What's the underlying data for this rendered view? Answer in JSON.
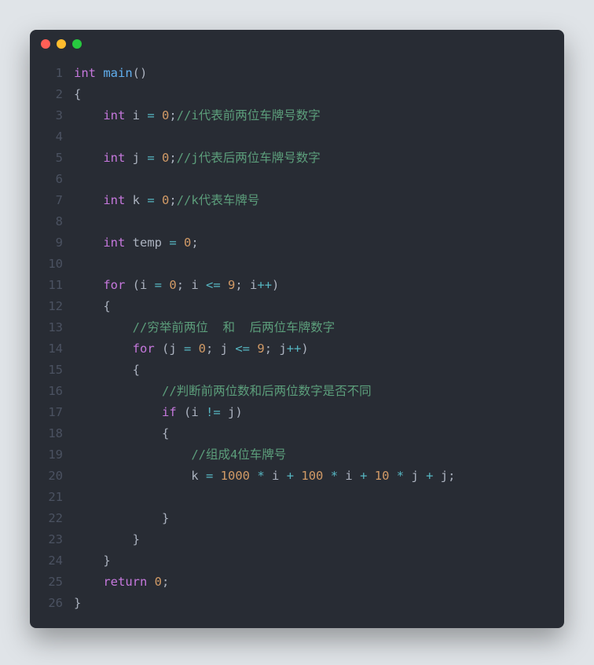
{
  "window": {
    "traffic_lights": [
      "red",
      "yellow",
      "green"
    ]
  },
  "code": {
    "line_numbers": [
      "1",
      "2",
      "3",
      "4",
      "5",
      "6",
      "7",
      "8",
      "9",
      "10",
      "11",
      "12",
      "13",
      "14",
      "15",
      "16",
      "17",
      "18",
      "19",
      "20",
      "21",
      "22",
      "23",
      "24",
      "25",
      "26"
    ],
    "lines": [
      [
        [
          "kw",
          "int"
        ],
        [
          "p",
          " "
        ],
        [
          "fn",
          "main"
        ],
        [
          "p",
          "()"
        ]
      ],
      [
        [
          "p",
          "{"
        ]
      ],
      [
        [
          "p",
          "    "
        ],
        [
          "kw",
          "int"
        ],
        [
          "p",
          " i "
        ],
        [
          "op",
          "="
        ],
        [
          "p",
          " "
        ],
        [
          "num",
          "0"
        ],
        [
          "p",
          ";"
        ],
        [
          "cm",
          "//i代表前两位车牌号数字"
        ]
      ],
      [],
      [
        [
          "p",
          "    "
        ],
        [
          "kw",
          "int"
        ],
        [
          "p",
          " j "
        ],
        [
          "op",
          "="
        ],
        [
          "p",
          " "
        ],
        [
          "num",
          "0"
        ],
        [
          "p",
          ";"
        ],
        [
          "cm",
          "//j代表后两位车牌号数字"
        ]
      ],
      [],
      [
        [
          "p",
          "    "
        ],
        [
          "kw",
          "int"
        ],
        [
          "p",
          " k "
        ],
        [
          "op",
          "="
        ],
        [
          "p",
          " "
        ],
        [
          "num",
          "0"
        ],
        [
          "p",
          ";"
        ],
        [
          "cm",
          "//k代表车牌号"
        ]
      ],
      [],
      [
        [
          "p",
          "    "
        ],
        [
          "kw",
          "int"
        ],
        [
          "p",
          " temp "
        ],
        [
          "op",
          "="
        ],
        [
          "p",
          " "
        ],
        [
          "num",
          "0"
        ],
        [
          "p",
          ";"
        ]
      ],
      [],
      [
        [
          "p",
          "    "
        ],
        [
          "kw",
          "for"
        ],
        [
          "p",
          " (i "
        ],
        [
          "op",
          "="
        ],
        [
          "p",
          " "
        ],
        [
          "num",
          "0"
        ],
        [
          "p",
          "; i "
        ],
        [
          "op",
          "<="
        ],
        [
          "p",
          " "
        ],
        [
          "num",
          "9"
        ],
        [
          "p",
          "; i"
        ],
        [
          "op",
          "++"
        ],
        [
          "p",
          ")"
        ]
      ],
      [
        [
          "p",
          "    {"
        ]
      ],
      [
        [
          "p",
          "        "
        ],
        [
          "cm",
          "//穷举前两位  和  后两位车牌数字"
        ]
      ],
      [
        [
          "p",
          "        "
        ],
        [
          "kw",
          "for"
        ],
        [
          "p",
          " (j "
        ],
        [
          "op",
          "="
        ],
        [
          "p",
          " "
        ],
        [
          "num",
          "0"
        ],
        [
          "p",
          "; j "
        ],
        [
          "op",
          "<="
        ],
        [
          "p",
          " "
        ],
        [
          "num",
          "9"
        ],
        [
          "p",
          "; j"
        ],
        [
          "op",
          "++"
        ],
        [
          "p",
          ")"
        ]
      ],
      [
        [
          "p",
          "        {"
        ]
      ],
      [
        [
          "p",
          "            "
        ],
        [
          "cm",
          "//判断前两位数和后两位数字是否不同"
        ]
      ],
      [
        [
          "p",
          "            "
        ],
        [
          "kw",
          "if"
        ],
        [
          "p",
          " (i "
        ],
        [
          "op",
          "!="
        ],
        [
          "p",
          " j)"
        ]
      ],
      [
        [
          "p",
          "            {"
        ]
      ],
      [
        [
          "p",
          "                "
        ],
        [
          "cm",
          "//组成4位车牌号"
        ]
      ],
      [
        [
          "p",
          "                k "
        ],
        [
          "op",
          "="
        ],
        [
          "p",
          " "
        ],
        [
          "num",
          "1000"
        ],
        [
          "p",
          " "
        ],
        [
          "op",
          "*"
        ],
        [
          "p",
          " i "
        ],
        [
          "op",
          "+"
        ],
        [
          "p",
          " "
        ],
        [
          "num",
          "100"
        ],
        [
          "p",
          " "
        ],
        [
          "op",
          "*"
        ],
        [
          "p",
          " i "
        ],
        [
          "op",
          "+"
        ],
        [
          "p",
          " "
        ],
        [
          "num",
          "10"
        ],
        [
          "p",
          " "
        ],
        [
          "op",
          "*"
        ],
        [
          "p",
          " j "
        ],
        [
          "op",
          "+"
        ],
        [
          "p",
          " j;"
        ]
      ],
      [],
      [
        [
          "p",
          "            }"
        ]
      ],
      [
        [
          "p",
          "        }"
        ]
      ],
      [
        [
          "p",
          "    }"
        ]
      ],
      [
        [
          "p",
          "    "
        ],
        [
          "kw",
          "return"
        ],
        [
          "p",
          " "
        ],
        [
          "num",
          "0"
        ],
        [
          "p",
          ";"
        ]
      ],
      [
        [
          "p",
          "}"
        ]
      ]
    ]
  }
}
